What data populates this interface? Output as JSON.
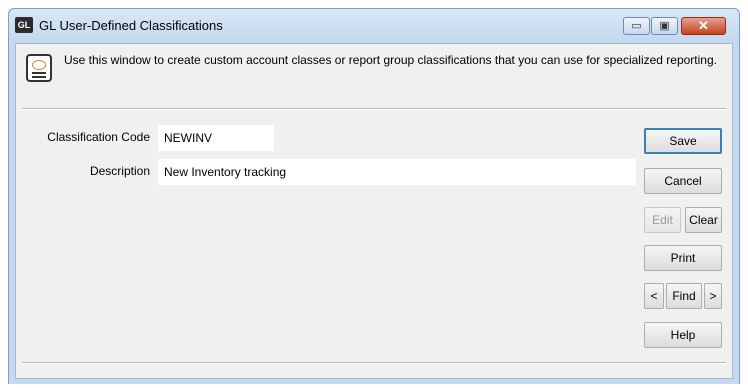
{
  "window": {
    "app_icon_text": "GL",
    "title": "GL User-Defined Classifications",
    "minimize_glyph": "▭",
    "maximize_glyph": "▣",
    "close_glyph": "✕"
  },
  "info": {
    "icon": "document-gear-icon",
    "text": "Use this window to create custom account classes or report group classifications that you can use for specialized reporting."
  },
  "form": {
    "code_label": "Classification Code",
    "code_value": "NEWINV",
    "description_label": "Description",
    "description_value": "New Inventory tracking"
  },
  "buttons": {
    "save": "Save",
    "cancel": "Cancel",
    "edit": "Edit",
    "clear": "Clear",
    "print": "Print",
    "prev": "<",
    "find": "Find",
    "next": ">",
    "help": "Help"
  },
  "colors": {
    "titlebar": "#c5daf0",
    "client": "#f0f0f0",
    "close_button": "#c7401f",
    "default_button_border": "#3c7fb1"
  }
}
